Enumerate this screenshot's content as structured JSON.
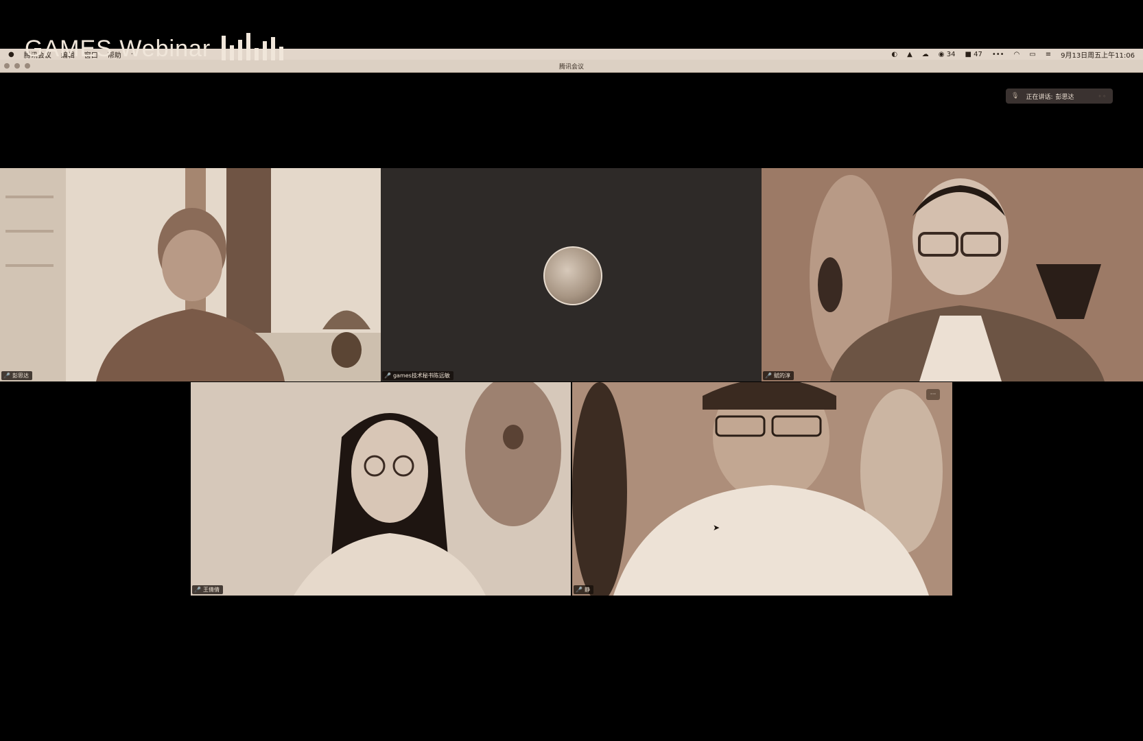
{
  "overlay": {
    "brand": "GAMES Webinar"
  },
  "menubar": {
    "left_items": [
      "腾讯会议",
      "编辑",
      "窗口",
      "帮助"
    ],
    "wechat_count": "34",
    "badge_count": "47",
    "datetime": "9月13日周五上午11:06"
  },
  "window": {
    "title": "腾讯会议"
  },
  "speaking": {
    "prefix": "正在讲话:",
    "name": "彭思达"
  },
  "participants": [
    {
      "name": "彭思达"
    },
    {
      "name": "games技术秘书陈远敏"
    },
    {
      "name": "赋的淳"
    },
    {
      "name": "王倩倩"
    },
    {
      "name": "静"
    }
  ],
  "icons": {
    "mic": "microphone-icon",
    "apple": "apple-icon",
    "wifi": "wifi-icon",
    "more": "more-icon"
  },
  "colors": {
    "background": "#000000",
    "menubar": "#e2d6ca",
    "tile_dark": "#2e2a28",
    "tile_warm": "#9a7866"
  }
}
